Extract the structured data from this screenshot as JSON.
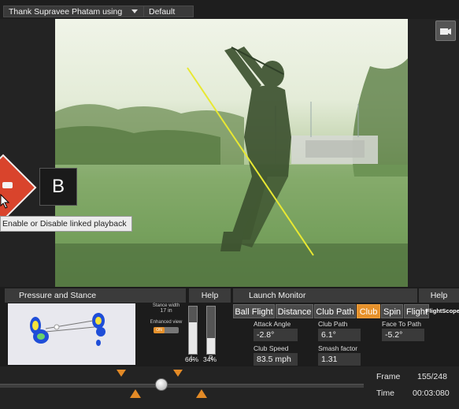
{
  "topbar": {
    "player_name": "Thank Supravee Phatam using",
    "preset": "Default"
  },
  "overlay": {
    "ab_label": "B",
    "tooltip": "Enable or Disable linked playback"
  },
  "pressure": {
    "header": "Pressure and Stance",
    "help": "Help",
    "stance_width_label": "Stance width",
    "stance_width_value": "17 in",
    "enhanced_view_label": "Enhanced view",
    "enhanced_view_state": "ON",
    "left_label": "L",
    "right_label": "R",
    "left_pct": "66%",
    "right_pct": "34%",
    "left_fill": 0.66,
    "right_fill": 0.34
  },
  "launch": {
    "header": "Launch Monitor",
    "help": "Help",
    "tabs": [
      "Ball Flight",
      "Distance",
      "Club Path",
      "Club",
      "Spin",
      "Flight",
      "FlightScope"
    ],
    "active_tab": "Club",
    "metrics": {
      "attack_angle": {
        "label": "Attack Angle",
        "value": "-2.8°"
      },
      "club_path": {
        "label": "Club Path",
        "value": "6.1°"
      },
      "face_to_path": {
        "label": "Face To Path",
        "value": "-5.2°"
      },
      "club_speed": {
        "label": "Club Speed",
        "value": "83.5 mph"
      },
      "smash_factor": {
        "label": "Smash factor",
        "value": "1.31"
      }
    }
  },
  "timeline": {
    "frame_label": "Frame",
    "frame_value": "155/248",
    "time_label": "Time",
    "time_value": "00:03:080"
  },
  "colors": {
    "accent": "#e6912b",
    "swing_line": "#e8e832"
  },
  "icons": [
    "caret-down-icon",
    "camera-icon",
    "sync-icon",
    "pointer-icon"
  ]
}
